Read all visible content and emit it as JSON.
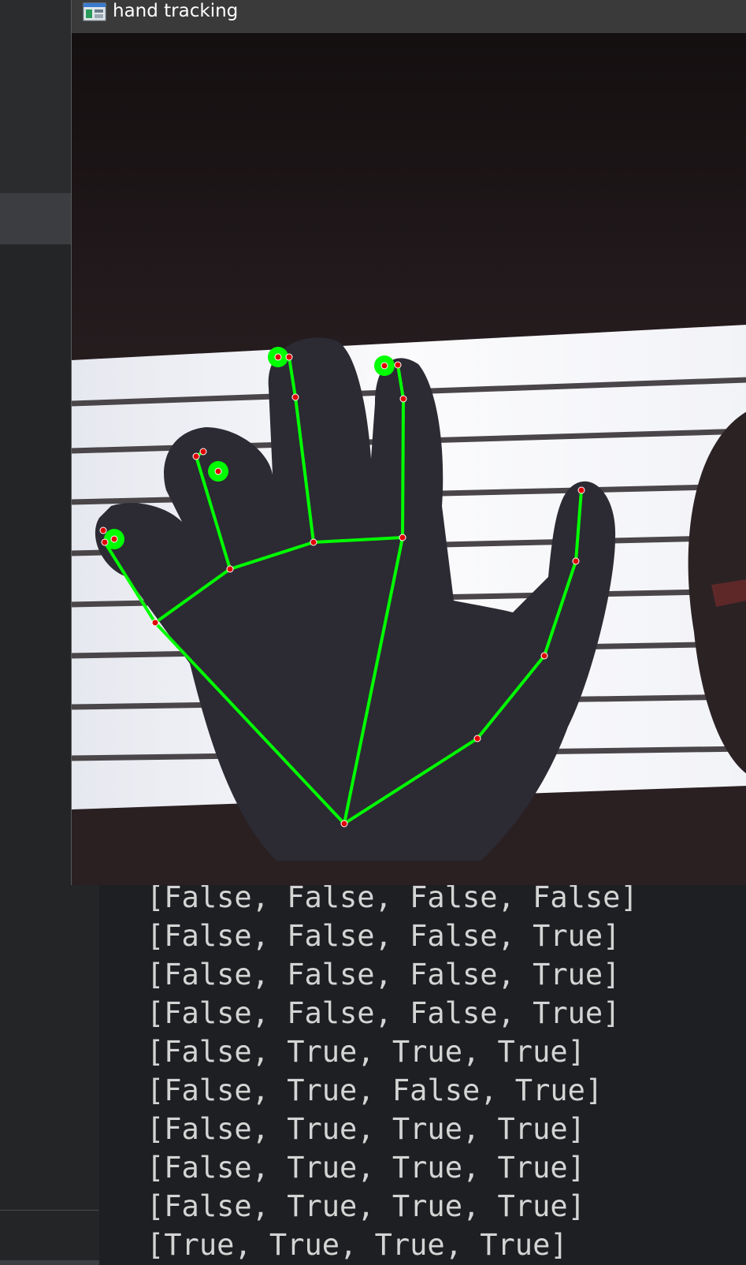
{
  "window": {
    "title": "hand tracking",
    "icon": "opencv-window-icon"
  },
  "colors": {
    "skeleton_line": "#00ff00",
    "landmark_dot": "#e00000",
    "fingertip_circle": "#00ff00",
    "console_text": "#d4d4d4",
    "console_background": "#1e1f22",
    "titlebar": "#3a3a3a"
  },
  "console": {
    "lines": [
      "[False, False, False, False]",
      "[False, False, False, True]",
      "[False, False, False, True]",
      "[False, False, False, True]",
      "[False, True, True, True]",
      "[False, True, False, True]",
      "[False, True, True, True]",
      "[False, True, True, True]",
      "[False, True, True, True]",
      "[True, True, True, True]"
    ]
  }
}
